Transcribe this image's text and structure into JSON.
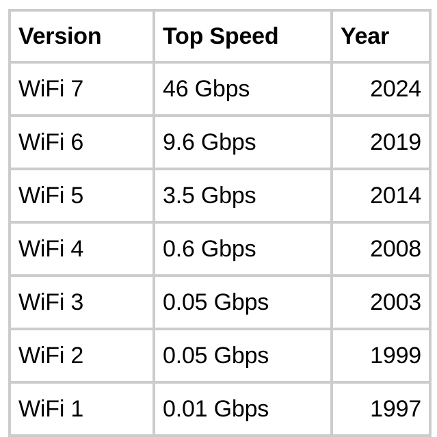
{
  "table": {
    "name": "wifi-generations-table",
    "border_color": "#cccccc",
    "cell_background": "#ffffff",
    "text_color": "#000000",
    "columns": [
      {
        "key": "version",
        "header": "Version",
        "header_align": "left",
        "cell_align": "left"
      },
      {
        "key": "speed",
        "header": "Top Speed",
        "header_align": "left",
        "cell_align": "left"
      },
      {
        "key": "year",
        "header": "Year",
        "header_align": "left",
        "cell_align": "right"
      }
    ],
    "headers": {
      "version": "Version",
      "speed": "Top Speed",
      "year": "Year"
    },
    "rows": [
      {
        "version": "WiFi 7",
        "speed": "46 Gbps",
        "year": "2024"
      },
      {
        "version": "WiFi 6",
        "speed": "9.6 Gbps",
        "year": "2019"
      },
      {
        "version": "WiFi 5",
        "speed": "3.5 Gbps",
        "year": "2014"
      },
      {
        "version": "WiFi 4",
        "speed": "0.6 Gbps",
        "year": "2008"
      },
      {
        "version": "WiFi 3",
        "speed": "0.05 Gbps",
        "year": "2003"
      },
      {
        "version": "WiFi 2",
        "speed": "0.05 Gbps",
        "year": "1999"
      },
      {
        "version": "WiFi 1",
        "speed": "0.01 Gbps",
        "year": "1997"
      }
    ]
  },
  "chart_data": {
    "type": "table",
    "title": "",
    "columns": [
      "Version",
      "Top Speed",
      "Year"
    ],
    "rows": [
      [
        "WiFi 7",
        "46 Gbps",
        "2024"
      ],
      [
        "WiFi 6",
        "9.6 Gbps",
        "2019"
      ],
      [
        "WiFi 5",
        "3.5 Gbps",
        "2014"
      ],
      [
        "WiFi 4",
        "0.6 Gbps",
        "2008"
      ],
      [
        "WiFi 3",
        "0.05 Gbps",
        "2003"
      ],
      [
        "WiFi 2",
        "0.05 Gbps",
        "1999"
      ],
      [
        "WiFi 1",
        "0.01 Gbps",
        "1997"
      ]
    ],
    "series": [
      {
        "name": "Top Speed (Gbps)",
        "categories": [
          "WiFi 1",
          "WiFi 2",
          "WiFi 3",
          "WiFi 4",
          "WiFi 5",
          "WiFi 6",
          "WiFi 7"
        ],
        "values": [
          0.01,
          0.05,
          0.05,
          0.6,
          3.5,
          9.6,
          46
        ]
      },
      {
        "name": "Year",
        "categories": [
          "WiFi 1",
          "WiFi 2",
          "WiFi 3",
          "WiFi 4",
          "WiFi 5",
          "WiFi 6",
          "WiFi 7"
        ],
        "values": [
          1997,
          1999,
          2003,
          2008,
          2014,
          2019,
          2024
        ]
      }
    ]
  }
}
